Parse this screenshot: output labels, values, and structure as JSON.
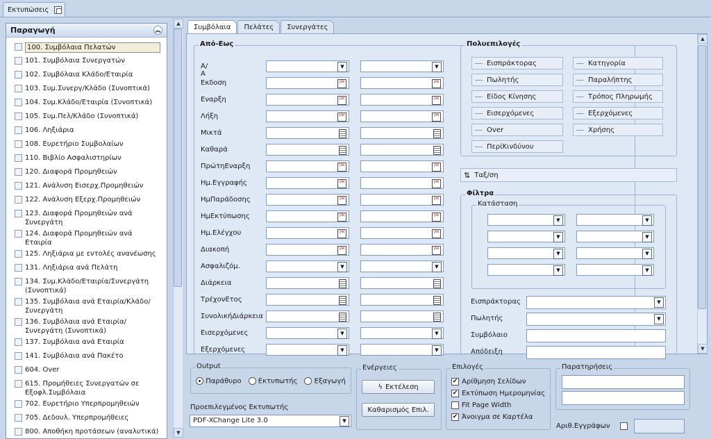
{
  "doc_tab": {
    "label": "Εκτυπώσεις"
  },
  "left": {
    "title": "Παραγωγή",
    "items": [
      "100. Συμβόλαια Πελατών",
      "101. Συμβόλαια Συνεργατών",
      "102. Συμβόλαια Κλάδο/Εταιρία",
      "103. Συμ.Συνεργ/Κλάδο (Συνοπτικά)",
      "104. Συμ.Κλάδο/Εταιρία (Συνοπτικά)",
      "105. Συμ.Πελ/Κλάδο (Συνοπτικά)",
      "106. Ληξιάρια",
      "108. Ευρετήριο Συμβολαίων",
      "110. Βιβλίο Ασφαλιστηρίων",
      "120. Διαφορά Προμηθειών",
      "121. Ανάλυση Εισερχ.Προμηθειών",
      "122. Ανάλυση Εξερχ.Προμηθειών",
      "123. Διαφορά Προμηθειών ανά Συνεργάτη",
      "124. Διαφορά Προμηθειών ανά Εταιρία",
      "125. Ληξιάρια με εντολές ανανέωσης",
      "131. Ληξιάρια ανά Πελάτη",
      "134. Συμ.Κλάδο/Εταιρία/Συνεργάτη (Συνοπτικά)",
      "135. Συμβόλαια ανά Εταιρία/Κλάδο/Συνεργάτη",
      "136. Συμβόλαια ανά Εταιρία/Συνεργάτη (Συνοπτικά)",
      "137. Συμβόλαια ανά Εταιρία",
      "141. Συμβόλαια ανά Πακέτο",
      "604. Over",
      "615. Προμήθειες Συνεργατών σε Εξοφλ.Συμβόλαια",
      "702. Ευρετήριο Υπερπρομηθειών",
      "705. Δεδουλ. Υπερπρομήθειες",
      "800. Αποθήκη προτάσεων (αναλυτικά)"
    ]
  },
  "tabs": [
    "Συμβόλαια",
    "Πελάτες",
    "Συνεργάτες"
  ],
  "range": {
    "title": "Από-Εως",
    "rows": [
      {
        "label": "Α/Α",
        "kind": "dd"
      },
      {
        "label": "Εκδοση",
        "kind": "cal"
      },
      {
        "label": "Εναρξη",
        "kind": "cal"
      },
      {
        "label": "Λήξη",
        "kind": "cal"
      },
      {
        "label": "Μικτά",
        "kind": "calc"
      },
      {
        "label": "Καθαρά",
        "kind": "calc"
      },
      {
        "label": "ΠρώτηΕναρξη",
        "kind": "cal"
      },
      {
        "label": "Ημ.Εγγραφής",
        "kind": "cal"
      },
      {
        "label": "ΗμΠαράδοσης",
        "kind": "cal"
      },
      {
        "label": "ΗμΕκτύπωσης",
        "kind": "cal"
      },
      {
        "label": "Ημ.Ελέγχου",
        "kind": "cal"
      },
      {
        "label": "Διακοπή",
        "kind": "cal"
      },
      {
        "label": "Ασφαλιζόμ.",
        "kind": "dd"
      },
      {
        "label": "Διάρκεια",
        "kind": "calc"
      },
      {
        "label": "ΤρέχονΕτος",
        "kind": "calc"
      },
      {
        "label": "ΣυνολικήΔιάρκεια",
        "kind": "calc"
      },
      {
        "label": "Εισερχόμενες",
        "kind": "dd"
      },
      {
        "label": "Εξερχόμενες",
        "kind": "dd"
      }
    ]
  },
  "multi": {
    "title": "Πολυεπιλογές",
    "left": [
      "Εισπράκτορας",
      "Πωλητής",
      "Είδος Κίνησης",
      "Εισερχόμενες",
      "Over",
      "ΠερίΚινδύνου"
    ],
    "right": [
      "Κατηγορία",
      "Παραλήπτης",
      "Τρόπος Πληρωμής",
      "Εξερχόμενες",
      "Χρήσης"
    ]
  },
  "sort": {
    "label": "Ταξ/ση"
  },
  "filters": {
    "title": "Φίλτρα",
    "status_title": "Κατάσταση",
    "rows": [
      {
        "label": "Εισπράκτορας",
        "kind": "dd"
      },
      {
        "label": "Πωλητής",
        "kind": "dd"
      },
      {
        "label": "Συμβόλαιο",
        "kind": "text"
      },
      {
        "label": "Απόδειξη",
        "kind": "text"
      }
    ]
  },
  "output": {
    "title": "Output",
    "options": [
      "Παράθυρο",
      "Εκτυπωτής",
      "Εξαγωγή"
    ],
    "selected": 0
  },
  "printer": {
    "label": "Προεπιλεγμένος Εκτυπωτής",
    "value": "PDF-XChange Lite 3.0"
  },
  "actions": {
    "title": "Ενέργειες",
    "run": "Εκτέλεση",
    "clear": "Καθαρισμός Επιλ."
  },
  "options": {
    "title": "Επιλογές",
    "items": [
      {
        "label": "Αρίθμηση Σελίδων",
        "checked": true
      },
      {
        "label": "Εκτύπωση Ημερομηνίας",
        "checked": true
      },
      {
        "label": "Fit Page Width",
        "checked": false
      },
      {
        "label": "Άνοιγμα σε Καρτέλα",
        "checked": true
      }
    ]
  },
  "notes": {
    "title": "Παρατηρήσεις",
    "copies_label": "Αριθ.Εγγράφων"
  },
  "colors": {
    "bg": "#c8d6ea",
    "panel": "#dfe8f5",
    "border": "#8ea5c8"
  }
}
